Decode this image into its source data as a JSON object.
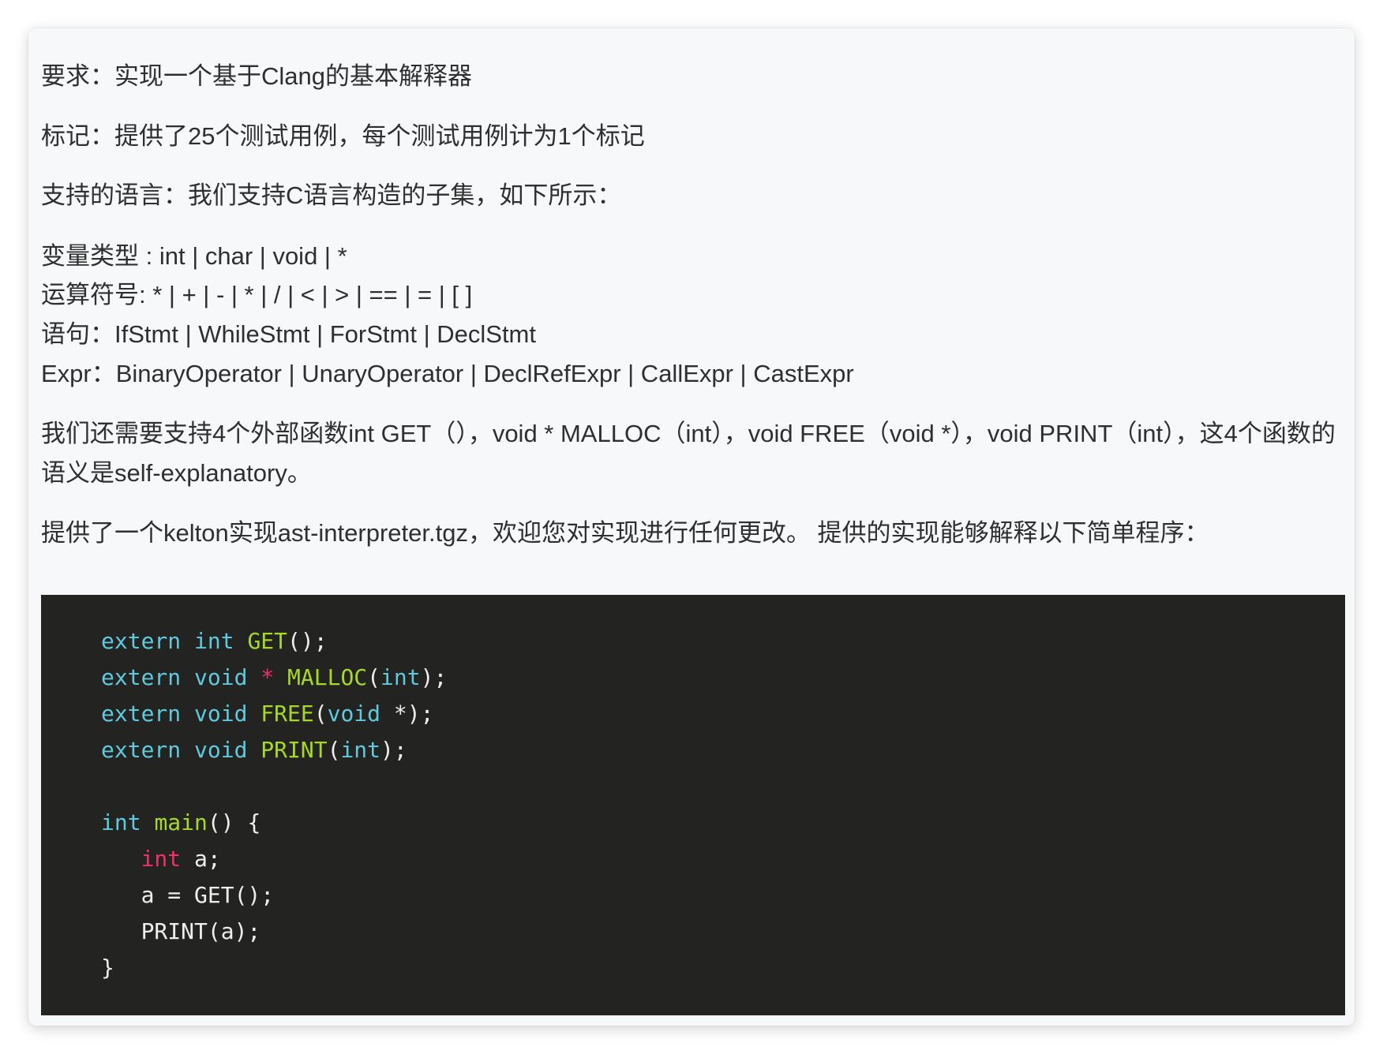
{
  "document": {
    "paragraphs": [
      "要求：实现一个基于Clang的基本解释器",
      "标记：提供了25个测试用例，每个测试用例计为1个标记",
      "支持的语言：我们支持C语言构造的子集，如下所示："
    ],
    "grammar_lines": [
      "变量类型 : int | char | void | *",
      "运算符号: * | + | - | * | / | < | > | == | = | [ ]",
      "语句：IfStmt | WhileStmt | ForStmt | DeclStmt",
      "Expr：BinaryOperator | UnaryOperator | DeclRefExpr | CallExpr | CastExpr"
    ],
    "external_functions": "我们还需要支持4个外部函数int GET（），void * MALLOC（int），void FREE（void *），void PRINT（int），这4个函数的语义是self-explanatory。",
    "skeleton_note": "提供了一个kelton实现ast-interpreter.tgz，欢迎您对实现进行任何更改。 提供的实现能够解释以下简单程序："
  },
  "code_block": {
    "colors": {
      "background": "#232421",
      "keyword": "#5fcadf",
      "function": "#a7d829",
      "operator": "#f0316c",
      "plain": "#eeeeee"
    },
    "lines": [
      {
        "text": "extern int GET();"
      },
      {
        "text": "extern void * MALLOC(int);"
      },
      {
        "text": "extern void FREE(void *);"
      },
      {
        "text": "extern void PRINT(int);"
      },
      {
        "text": ""
      },
      {
        "text": "int main() {"
      },
      {
        "text": "   int a;"
      },
      {
        "text": "   a = GET();"
      },
      {
        "text": "   PRINT(a);"
      },
      {
        "text": "}"
      }
    ]
  }
}
